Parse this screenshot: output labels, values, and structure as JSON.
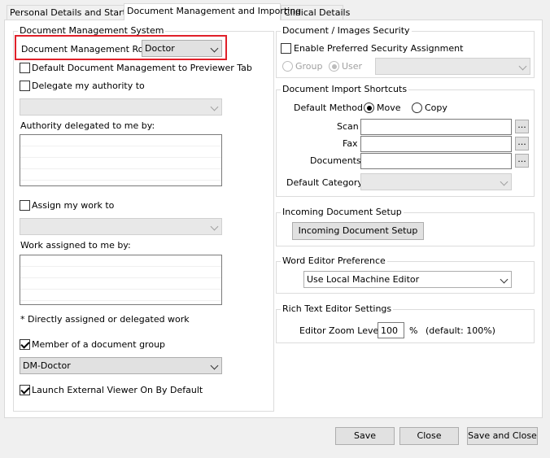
{
  "tabs": [
    "Personal Details and Startup",
    "Document Management and Importing",
    "Clinical Details"
  ],
  "left": {
    "group_title": "Document Management System",
    "role_label": "Document Management Role",
    "role_value": "Doctor",
    "default_previewer_label": "Default Document Management to Previewer Tab",
    "delegate_label": "Delegate my authority to",
    "delegated_to_me_label": "Authority delegated to me by:",
    "assign_label": "Assign my work to",
    "assigned_to_me_label": "Work assigned to me by:",
    "note": "* Directly assigned or delegated work",
    "member_group_label": "Member of a document  group",
    "group_value": "DM-Doctor",
    "launch_viewer_label": "Launch External Viewer On By Default"
  },
  "security": {
    "title": "Document / Images Security",
    "enable_label": "Enable Preferred Security Assignment",
    "group_label": "Group",
    "user_label": "User"
  },
  "import": {
    "title": "Document Import Shortcuts",
    "default_method_label": "Default Method",
    "move_label": "Move",
    "copy_label": "Copy",
    "scan_label": "Scan",
    "fax_label": "Fax",
    "documents_label": "Documents",
    "default_category_label": "Default Category",
    "browse": "..."
  },
  "incoming": {
    "title": "Incoming Document Setup",
    "button": "Incoming Document Setup"
  },
  "word": {
    "title": "Word Editor Preference",
    "value": "Use Local Machine Editor"
  },
  "rich": {
    "title": "Rich Text Editor Settings",
    "zoom_label": "Editor Zoom Level",
    "zoom_value": "100",
    "percent": "%",
    "default_note": "(default: 100%)"
  },
  "footer": {
    "save": "Save",
    "close": "Close",
    "save_close": "Save and Close"
  }
}
